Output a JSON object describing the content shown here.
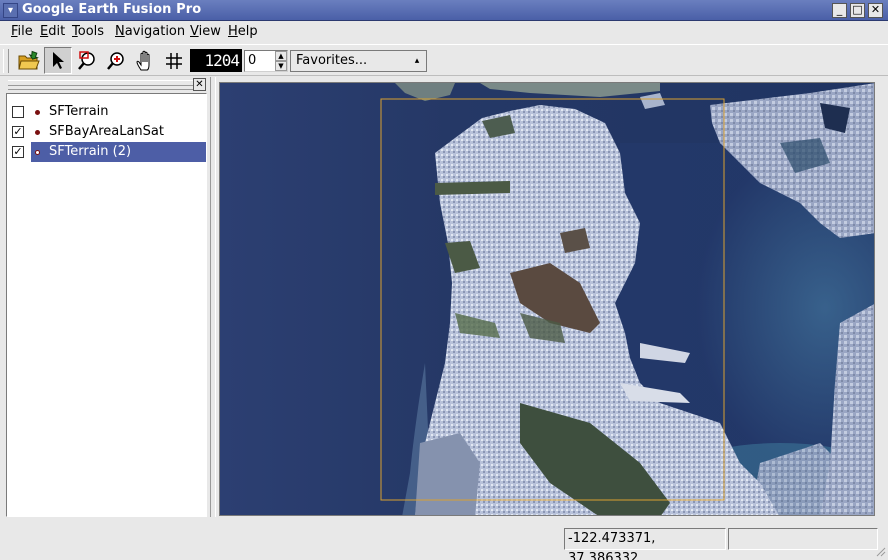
{
  "window": {
    "title": "Google Earth Fusion Pro",
    "sysmenu_icon": "chevron-down-icon",
    "minimize_glyph": "_",
    "maximize_glyph": "□",
    "close_glyph": "✕"
  },
  "menubar": {
    "items": [
      {
        "mnemonic": "F",
        "rest": "ile"
      },
      {
        "mnemonic": "E",
        "rest": "dit"
      },
      {
        "mnemonic": "T",
        "rest": "ools"
      },
      {
        "mnemonic": "N",
        "rest": "avigation"
      },
      {
        "mnemonic": "V",
        "rest": "iew"
      },
      {
        "mnemonic": "H",
        "rest": "elp"
      }
    ]
  },
  "toolbar": {
    "tools": [
      "open-folder-icon",
      "pointer-icon",
      "zoom-box-icon",
      "zoom-in-icon",
      "pan-hand-icon",
      "grid-icon"
    ],
    "level_display": "1204",
    "spin_value": "0",
    "favorites": "Favorites..."
  },
  "layers_panel": {
    "close_glyph": "✕",
    "items": [
      {
        "name": "SFTerrain",
        "checked": false,
        "selected": false
      },
      {
        "name": "SFBayAreaLanSat",
        "checked": true,
        "selected": false
      },
      {
        "name": "SFTerrain (2)",
        "checked": true,
        "selected": true
      }
    ]
  },
  "statusbar": {
    "coordinates": "-122.473371, 37.386332"
  },
  "colors": {
    "title_bar": "#4a5fa7",
    "selection": "#4d5ea6",
    "extent_box": "#d9a030",
    "water": "#2a3c6e"
  }
}
